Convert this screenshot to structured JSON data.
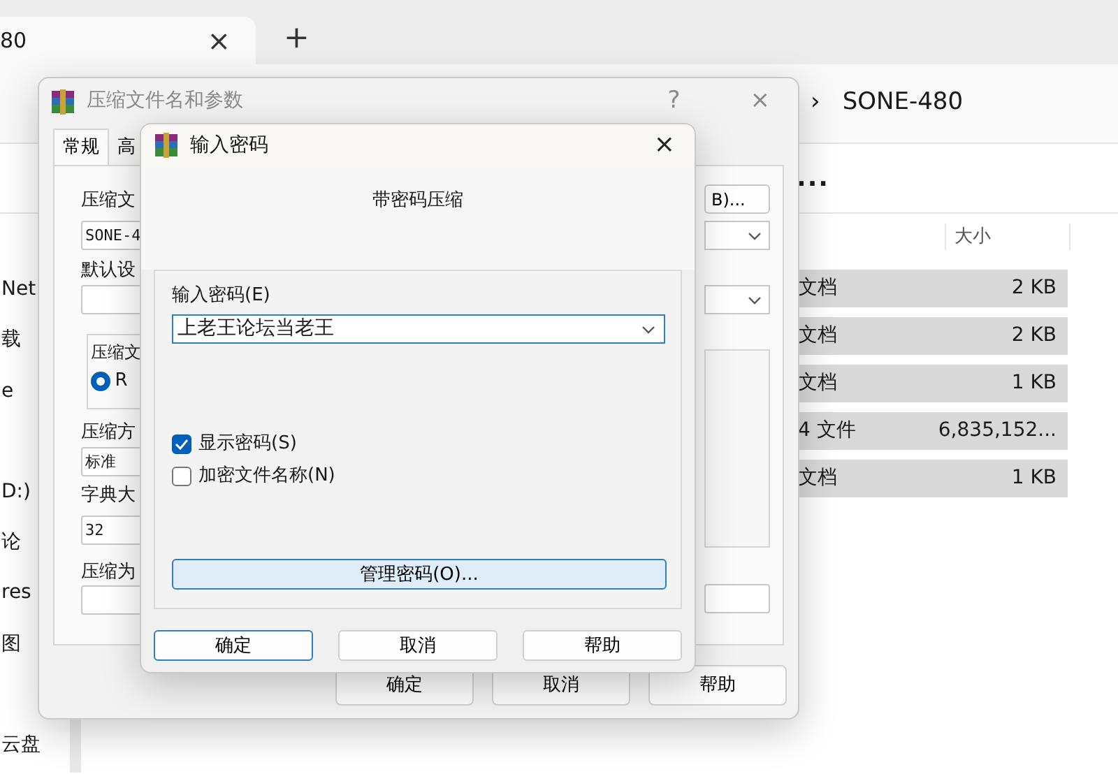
{
  "explorer": {
    "tab": {
      "title": "80",
      "close": "×"
    },
    "new_tab": "+",
    "breadcrumb": {
      "separator": "›",
      "label": "SONE-480"
    },
    "more": "...",
    "size_column": "大小",
    "rows": [
      {
        "type": "文档",
        "size": "2 KB",
        "selected": true
      },
      {
        "type": "文档",
        "size": "2 KB",
        "selected": true
      },
      {
        "type": "文档",
        "size": "1 KB",
        "selected": true
      },
      {
        "type": "4 文件",
        "size": "6,835,152...",
        "selected": true
      },
      {
        "type": "文档",
        "size": "1 KB",
        "selected": true
      }
    ],
    "sidebar": [
      "Net",
      "载",
      "e",
      "D:)",
      "论",
      "res",
      "图",
      "云盘"
    ]
  },
  "archive_dialog": {
    "title": "压缩文件名和参数",
    "help": "?",
    "close": "×",
    "tabs": [
      {
        "label": "常规",
        "selected": true
      },
      {
        "label": "高",
        "selected": false
      }
    ],
    "archive_name_label": "压缩文",
    "archive_name": "SONE-4",
    "profile_label": "默认设",
    "format_group": {
      "label": "压缩文",
      "option": {
        "label": "R",
        "selected": true
      }
    },
    "method_label": "压缩方",
    "method": "标准",
    "dictionary_label": "字典大",
    "dictionary": "32",
    "split_label": "压缩为",
    "browse_button": "B)...",
    "buttons": [
      "确定",
      "取消",
      "帮助"
    ]
  },
  "password_dialog": {
    "title": "输入密码",
    "close": "×",
    "heading": "带密码压缩",
    "password_label": "输入密码(E)",
    "password": "上老王论坛当老王",
    "options": [
      {
        "label": "显示密码(S)",
        "checked": true
      },
      {
        "label": "加密文件名称(N)",
        "checked": false
      }
    ],
    "manage_button": "管理密码(O)...",
    "buttons": [
      {
        "label": "确定",
        "default": true
      },
      {
        "label": "取消",
        "default": false
      },
      {
        "label": "帮助",
        "default": false
      }
    ]
  }
}
